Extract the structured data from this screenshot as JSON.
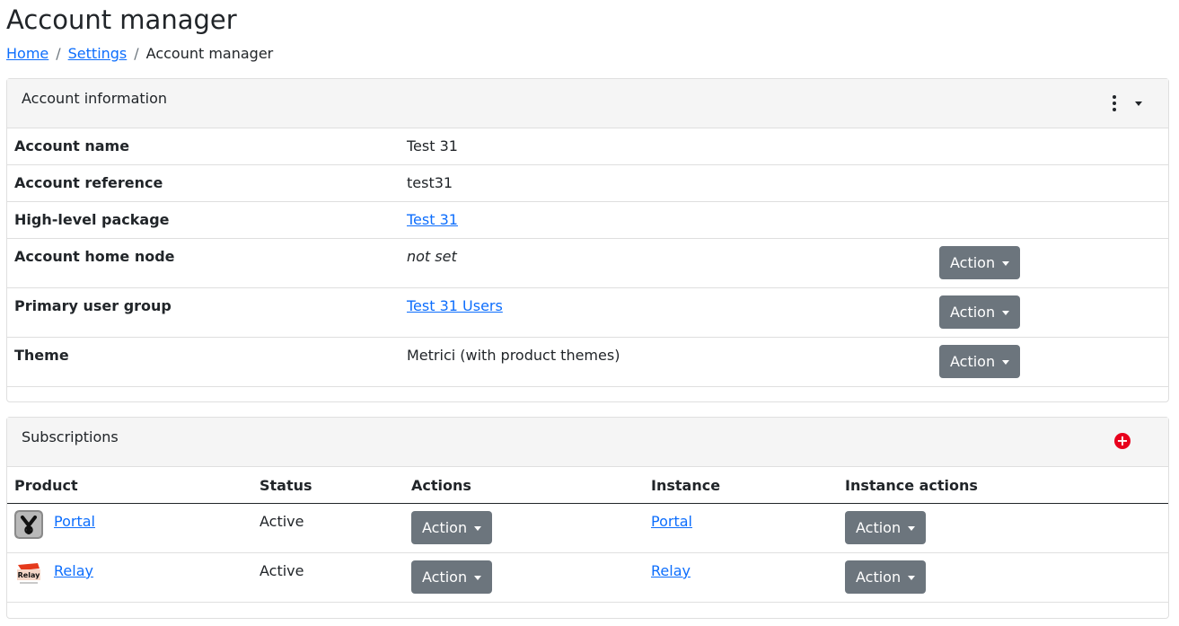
{
  "page": {
    "title": "Account manager",
    "breadcrumb": {
      "home": "Home",
      "settings": "Settings",
      "current": "Account manager",
      "separator": "/"
    }
  },
  "account_card": {
    "title": "Account information",
    "rows": [
      {
        "label": "Account name",
        "value": "Test 31"
      },
      {
        "label": "Account reference",
        "value": "test31"
      },
      {
        "label": "High-level package",
        "value": "Test 31"
      },
      {
        "label": "Account home node",
        "value": "not set",
        "action": "Action"
      },
      {
        "label": "Primary user group",
        "value": "Test 31 Users",
        "action": "Action"
      },
      {
        "label": "Theme",
        "value": "Metrici (with product themes)",
        "action": "Action"
      }
    ]
  },
  "subscriptions_card": {
    "title": "Subscriptions",
    "add_icon": "plus-circle-icon",
    "columns": [
      "Product",
      "Status",
      "Actions",
      "Instance",
      "Instance actions"
    ],
    "rows": [
      {
        "product": "Portal",
        "icon": "portal-logo-icon",
        "status": "Active",
        "action": "Action",
        "instance": "Portal",
        "instance_action": "Action"
      },
      {
        "product": "Relay",
        "icon": "relay-logo-icon",
        "status": "Active",
        "action": "Action",
        "instance": "Relay",
        "instance_action": "Action"
      }
    ]
  },
  "colors": {
    "link": "#0d6efd",
    "button": "#6c757d",
    "add_button": "#e8001c",
    "header_bg": "#f5f5f5"
  }
}
